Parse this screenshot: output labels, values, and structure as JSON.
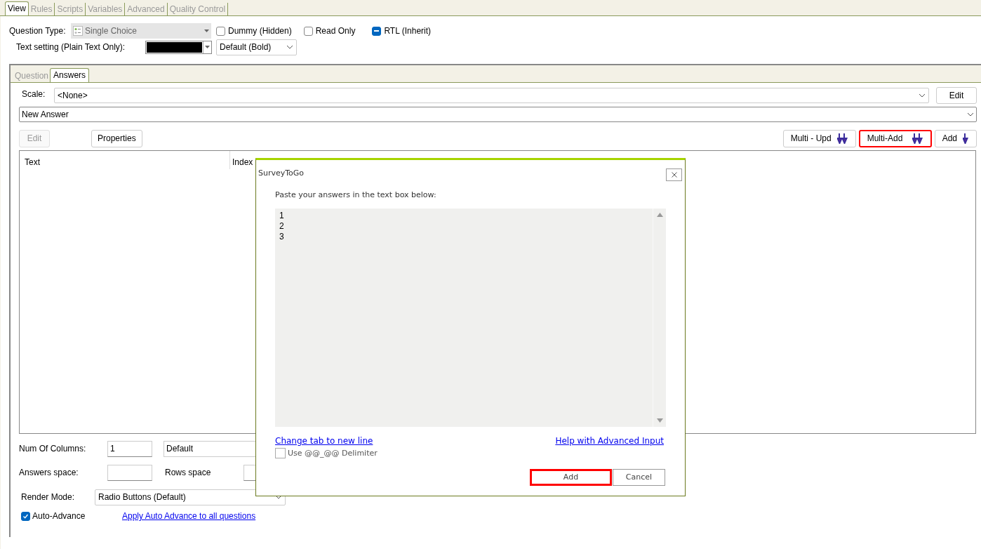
{
  "top_tabs": [
    {
      "label": "View",
      "selected": true
    },
    {
      "label": "Rules",
      "selected": false
    },
    {
      "label": "Scripts",
      "selected": false
    },
    {
      "label": "Variables",
      "selected": false
    },
    {
      "label": "Advanced",
      "selected": false
    },
    {
      "label": "Quality Control",
      "selected": false
    }
  ],
  "question_type": {
    "label": "Question Type:",
    "value": "Single Choice",
    "disabled": true
  },
  "options": [
    {
      "label": "Dummy (Hidden)",
      "checked": false,
      "mixed": false
    },
    {
      "label": "Read Only",
      "checked": false,
      "mixed": false
    },
    {
      "label": "RTL (Inherit)",
      "checked": true,
      "mixed": true
    }
  ],
  "text_setting": {
    "label": "Text setting (Plain Text Only):",
    "color": "#000000",
    "style": "Default (Bold)"
  },
  "inner_tabs": [
    {
      "label": "Question",
      "selected": false
    },
    {
      "label": "Answers",
      "selected": true
    }
  ],
  "scale": {
    "label": "Scale:",
    "value": "<None>",
    "button": "Edit"
  },
  "answer_select": {
    "value": "New Answer"
  },
  "toolbar_left": [
    {
      "label": "Edit",
      "disabled": true
    },
    {
      "label": "Properties",
      "disabled": false
    }
  ],
  "toolbar_right": [
    {
      "label": "Multi - Upd",
      "kind": "multi",
      "highlighted": false
    },
    {
      "label": "Multi-Add",
      "kind": "multi",
      "highlighted": true
    },
    {
      "label": "Add",
      "kind": "single",
      "highlighted": false
    }
  ],
  "table": {
    "columns": [
      "Text",
      "Index"
    ]
  },
  "num_columns": {
    "label": "Num Of Columns:",
    "value": "1",
    "mode": "Default"
  },
  "answers_space": {
    "label": "Answers space:",
    "rows_label": "Rows space"
  },
  "render_mode": {
    "label": "Render Mode:",
    "value": "Radio Buttons (Default)"
  },
  "auto_advance": {
    "label": "Auto-Advance",
    "checked": true,
    "link": "Apply Auto Advance to all questions"
  },
  "dialog": {
    "title": "SurveyToGo",
    "prompt": "Paste your answers in the text box below:",
    "lines": [
      "1",
      "2",
      "3"
    ],
    "link_left": "Change tab to new line",
    "link_right": "Help with Advanced Input",
    "delimiter": {
      "label": "Use @@_@@ Delimiter",
      "checked": false
    },
    "buttons": [
      {
        "label": "Add",
        "highlighted": true
      },
      {
        "label": "Cancel",
        "highlighted": false
      }
    ]
  }
}
